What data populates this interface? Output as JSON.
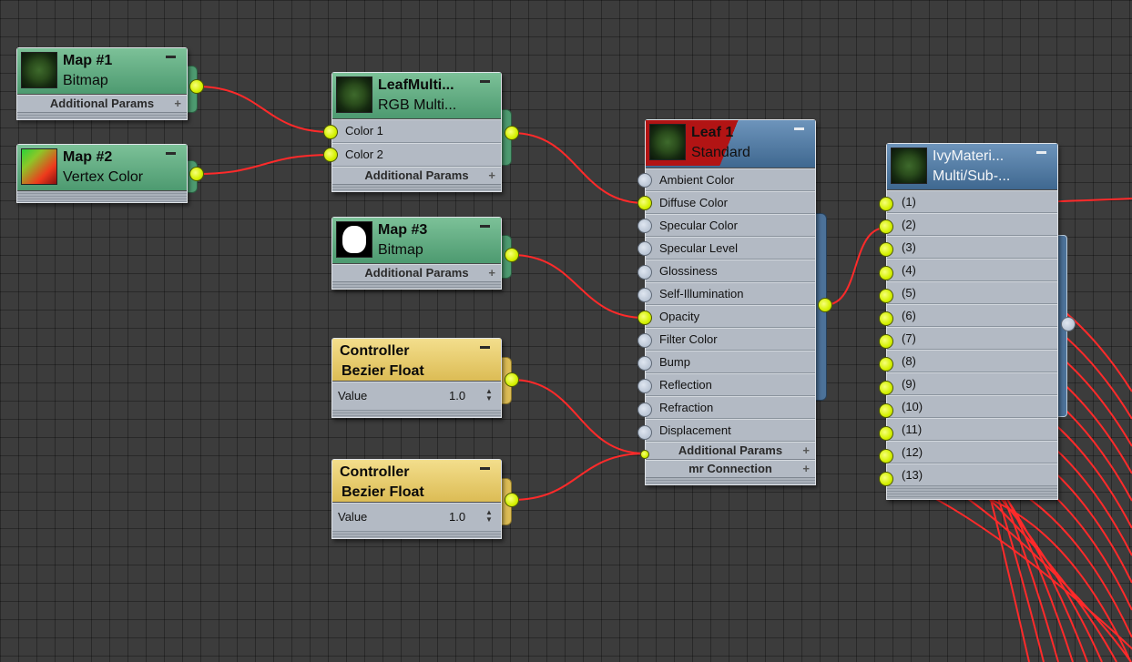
{
  "nodes": {
    "map1": {
      "title": "Map #1",
      "subtitle": "Bitmap",
      "section": "Additional Params"
    },
    "map2": {
      "title": "Map #2",
      "subtitle": "Vertex Color"
    },
    "leafmulti": {
      "title": "LeafMulti...",
      "subtitle": "RGB Multi...",
      "inputs": [
        "Color 1",
        "Color 2"
      ],
      "section": "Additional Params"
    },
    "map3": {
      "title": "Map #3",
      "subtitle": "Bitmap",
      "section": "Additional Params"
    },
    "ctrl1": {
      "title": "Controller",
      "subtitle": "Bezier Float",
      "param": "Value",
      "value": "1.0"
    },
    "ctrl2": {
      "title": "Controller",
      "subtitle": "Bezier Float",
      "param": "Value",
      "value": "1.0"
    },
    "leaf1": {
      "title": "Leaf 1",
      "subtitle": "Standard",
      "slots": [
        "Ambient Color",
        "Diffuse Color",
        "Specular Color",
        "Specular Level",
        "Glossiness",
        "Self-Illumination",
        "Opacity",
        "Filter Color",
        "Bump",
        "Reflection",
        "Refraction",
        "Displacement"
      ],
      "sections": [
        "Additional Params",
        "mr Connection"
      ]
    },
    "ivy": {
      "title": "IvyMateri...",
      "subtitle": "Multi/Sub-...",
      "slots": [
        "(1)",
        "(2)",
        "(3)",
        "(4)",
        "(5)",
        "(6)",
        "(7)",
        "(8)",
        "(9)",
        "(10)",
        "(11)",
        "(12)",
        "(13)"
      ]
    }
  },
  "colors": {
    "wire": "#ff2a2a",
    "socket_connected": "#d4f000",
    "socket_empty": "#a9b6c8",
    "grid_bg": "#3c3c3c"
  }
}
